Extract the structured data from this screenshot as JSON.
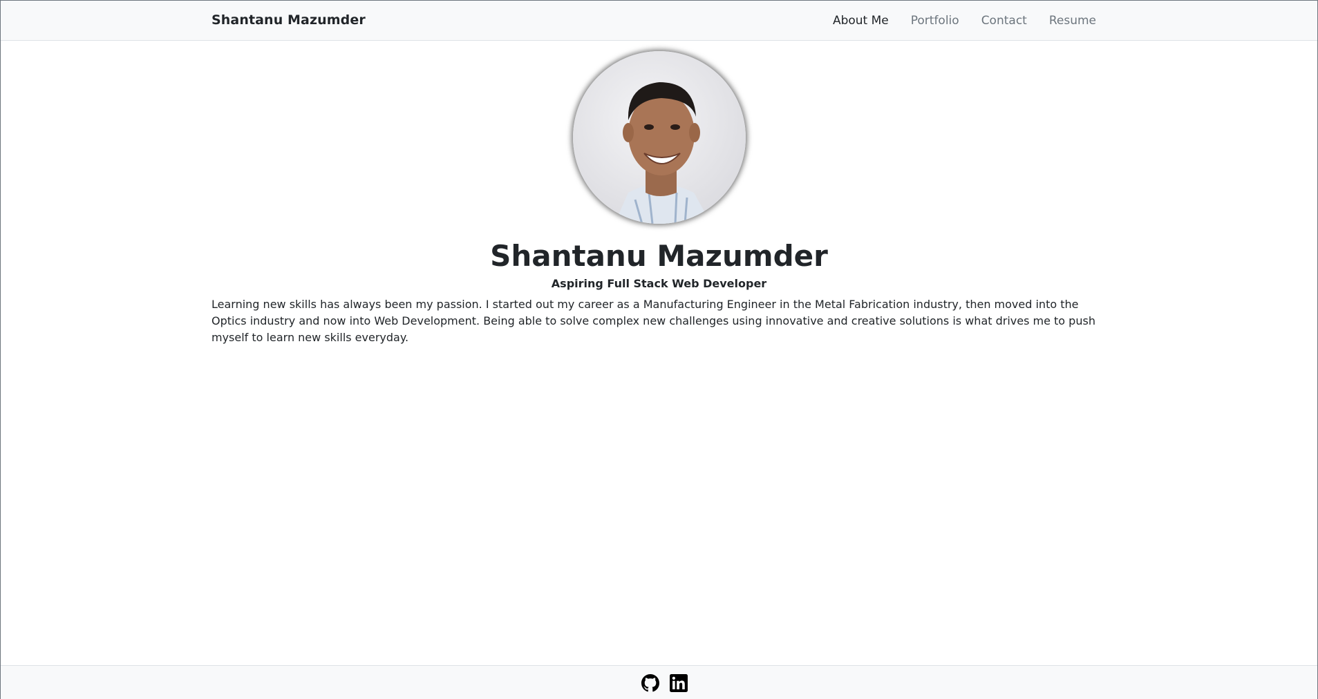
{
  "navbar": {
    "brand": "Shantanu Mazumder",
    "links": [
      {
        "label": "About Me",
        "active": true
      },
      {
        "label": "Portfolio",
        "active": false
      },
      {
        "label": "Contact",
        "active": false
      },
      {
        "label": "Resume",
        "active": false
      }
    ]
  },
  "profile": {
    "name": "Shantanu Mazumder",
    "tagline": "Aspiring Full Stack Web Developer",
    "bio": "Learning new skills has always been my passion. I started out my career as a Manufacturing Engineer in the Metal Fabrication industry, then moved into the Optics industry and now into Web Development. Being able to solve complex new challenges using innovative and creative solutions is what drives me to push myself to learn new skills everyday."
  },
  "footer": {
    "icons": [
      "github-icon",
      "linkedin-icon"
    ]
  },
  "colors": {
    "navbar_bg": "#f8f9fa",
    "text": "#212529",
    "muted_link": "#6c757d"
  }
}
